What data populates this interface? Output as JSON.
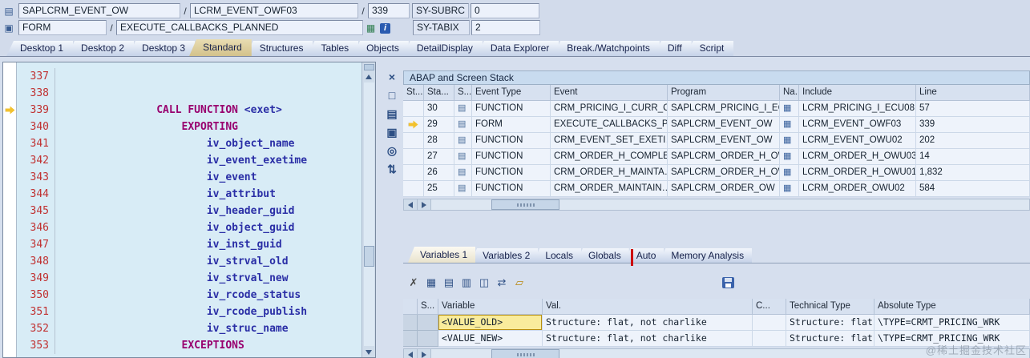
{
  "colors": {
    "active_tab": "#d3c28c",
    "selection_yellow": "#f9ec9c",
    "annotation_red": "#cc0000",
    "arrow_yellow": "#f2c12e",
    "keyword": "#98006e",
    "identifier": "#2a2ea6",
    "line_number": "#c03030"
  },
  "watermark": "@稀土掘金技术社区",
  "topbar": {
    "slash": "/",
    "row1": {
      "icon": {
        "name": "program-icon",
        "glyph": "▤"
      },
      "program": "SAPLCRM_EVENT_OW",
      "include": "LCRM_EVENT_OWF03",
      "line": "339",
      "sy_subrc_label": "SY-SUBRC",
      "sy_subrc_value": "0"
    },
    "row2": {
      "icon": {
        "name": "form-icon",
        "glyph": "▣"
      },
      "event_type": "FORM",
      "event_name": "EXECUTE_CALLBACKS_PLANNED",
      "icons": [
        {
          "name": "structure-icon",
          "glyph": "▦"
        },
        {
          "name": "info-icon",
          "glyph": "i"
        }
      ],
      "sy_tabix_label": "SY-TABIX",
      "sy_tabix_value": "2"
    }
  },
  "desktop_tabs": [
    {
      "label": "Desktop 1"
    },
    {
      "label": "Desktop 2"
    },
    {
      "label": "Desktop 3"
    },
    {
      "label": "Standard",
      "active": true
    },
    {
      "label": "Structures"
    },
    {
      "label": "Tables"
    },
    {
      "label": "Objects"
    },
    {
      "label": "DetailDisplay"
    },
    {
      "label": "Data Explorer"
    },
    {
      "label": "Break./Watchpoints"
    },
    {
      "label": "Diff"
    },
    {
      "label": "Script"
    }
  ],
  "editor": {
    "lines": [
      {
        "no": "337",
        "segs": []
      },
      {
        "no": "338",
        "segs": []
      },
      {
        "no": "339",
        "current": true,
        "segs": [
          {
            "t": "                CALL FUNCTION",
            "c": "kw"
          },
          {
            "t": " <exet>",
            "c": "id"
          }
        ]
      },
      {
        "no": "340",
        "segs": [
          {
            "t": "                    EXPORTING",
            "c": "kw"
          }
        ]
      },
      {
        "no": "341",
        "segs": [
          {
            "t": "                        iv_object_name",
            "c": "id"
          }
        ]
      },
      {
        "no": "342",
        "segs": [
          {
            "t": "                        iv_event_exetime",
            "c": "id"
          }
        ]
      },
      {
        "no": "343",
        "segs": [
          {
            "t": "                        iv_event",
            "c": "id"
          }
        ]
      },
      {
        "no": "344",
        "segs": [
          {
            "t": "                        iv_attribut",
            "c": "id"
          }
        ]
      },
      {
        "no": "345",
        "segs": [
          {
            "t": "                        iv_header_guid",
            "c": "id"
          }
        ]
      },
      {
        "no": "346",
        "segs": [
          {
            "t": "                        iv_object_guid",
            "c": "id"
          }
        ]
      },
      {
        "no": "347",
        "segs": [
          {
            "t": "                        iv_inst_guid",
            "c": "id"
          }
        ]
      },
      {
        "no": "348",
        "segs": [
          {
            "t": "                        iv_strval_old",
            "c": "id"
          }
        ]
      },
      {
        "no": "349",
        "segs": [
          {
            "t": "                        iv_strval_new",
            "c": "id"
          }
        ]
      },
      {
        "no": "350",
        "segs": [
          {
            "t": "                        iv_rcode_status",
            "c": "id"
          }
        ]
      },
      {
        "no": "351",
        "segs": [
          {
            "t": "                        iv_rcode_publish",
            "c": "id"
          }
        ]
      },
      {
        "no": "352",
        "segs": [
          {
            "t": "                        iv_struc_name",
            "c": "id"
          }
        ]
      },
      {
        "no": "353",
        "segs": [
          {
            "t": "                    EXCEPTIONS",
            "c": "kw"
          }
        ]
      }
    ]
  },
  "stack_panel": {
    "title": "ABAP and Screen Stack",
    "tool_icons": [
      {
        "name": "close-tool-icon",
        "glyph": "×"
      },
      {
        "name": "new-tool-icon",
        "glyph": "□"
      },
      {
        "name": "tool-services-icon",
        "glyph": "▤"
      },
      {
        "name": "full-screen-icon",
        "glyph": "▣"
      },
      {
        "name": "headset-icon",
        "glyph": "◎"
      },
      {
        "name": "swap-tool-icon",
        "glyph": "⇅"
      }
    ],
    "columns": {
      "st": "St...",
      "sta": "Sta...",
      "s": "S...",
      "event_type": "Event Type",
      "event": "Event",
      "program": "Program",
      "na": "Na...",
      "include": "Include",
      "line": "Line"
    },
    "rows": [
      {
        "sta": "30",
        "event_type": "FUNCTION",
        "event": "CRM_PRICING_I_CURR_C…",
        "program": "SAPLCRM_PRICING_I_EC",
        "include": "LCRM_PRICING_I_ECU08",
        "line": "57"
      },
      {
        "sta": "29",
        "current": true,
        "event_type": "FORM",
        "event": "EXECUTE_CALLBACKS_P…",
        "program": "SAPLCRM_EVENT_OW",
        "include": "LCRM_EVENT_OWF03",
        "line": "339"
      },
      {
        "sta": "28",
        "event_type": "FUNCTION",
        "event": "CRM_EVENT_SET_EXETI…",
        "program": "SAPLCRM_EVENT_OW",
        "include": "LCRM_EVENT_OWU02",
        "line": "202"
      },
      {
        "sta": "27",
        "event_type": "FUNCTION",
        "event": "CRM_ORDER_H_COMPLE…",
        "program": "SAPLCRM_ORDER_H_OW",
        "include": "LCRM_ORDER_H_OWU03",
        "line": "14"
      },
      {
        "sta": "26",
        "event_type": "FUNCTION",
        "event": "CRM_ORDER_H_MAINTA…",
        "program": "SAPLCRM_ORDER_H_OW",
        "include": "LCRM_ORDER_H_OWU01",
        "line": "1,832"
      },
      {
        "sta": "25",
        "event_type": "FUNCTION",
        "event": "CRM_ORDER_MAINTAIN…",
        "program": "SAPLCRM_ORDER_OW",
        "include": "LCRM_ORDER_OWU02",
        "line": "584"
      }
    ]
  },
  "variables_panel": {
    "tabs": [
      {
        "label": "Variables 1",
        "active": true
      },
      {
        "label": "Variables 2"
      },
      {
        "label": "Locals"
      },
      {
        "label": "Globals"
      },
      {
        "label": "Auto"
      },
      {
        "label": "Memory Analysis"
      }
    ],
    "toolbar_icons": [
      {
        "name": "delete-icon",
        "glyph": "✗"
      },
      {
        "name": "table-view-icon",
        "glyph": "▦"
      },
      {
        "name": "detail-view-icon",
        "glyph": "▤"
      },
      {
        "name": "grid-view-icon",
        "glyph": "▥"
      },
      {
        "name": "split-column-icon",
        "glyph": "◫"
      },
      {
        "name": "compare-icon",
        "glyph": "⇄"
      },
      {
        "name": "folder-icon",
        "glyph": "▱"
      }
    ],
    "save_icon": {
      "name": "save-layout-icon",
      "glyph": ""
    },
    "columns": {
      "s": "S...",
      "variable": "Variable",
      "val": "Val.",
      "c": "C...",
      "tech": "Technical Type",
      "abs": "Absolute Type"
    },
    "rows": [
      {
        "variable": "<VALUE_OLD>",
        "selected": true,
        "val": "Structure: flat, not charlike",
        "tech": "Structure: flat, no…",
        "abs": "\\TYPE=CRMT_PRICING_WRK"
      },
      {
        "variable": "<VALUE_NEW>",
        "val": "Structure: flat, not charlike",
        "tech": "Structure: flat, no…",
        "abs": "\\TYPE=CRMT_PRICING_WRK"
      }
    ]
  }
}
